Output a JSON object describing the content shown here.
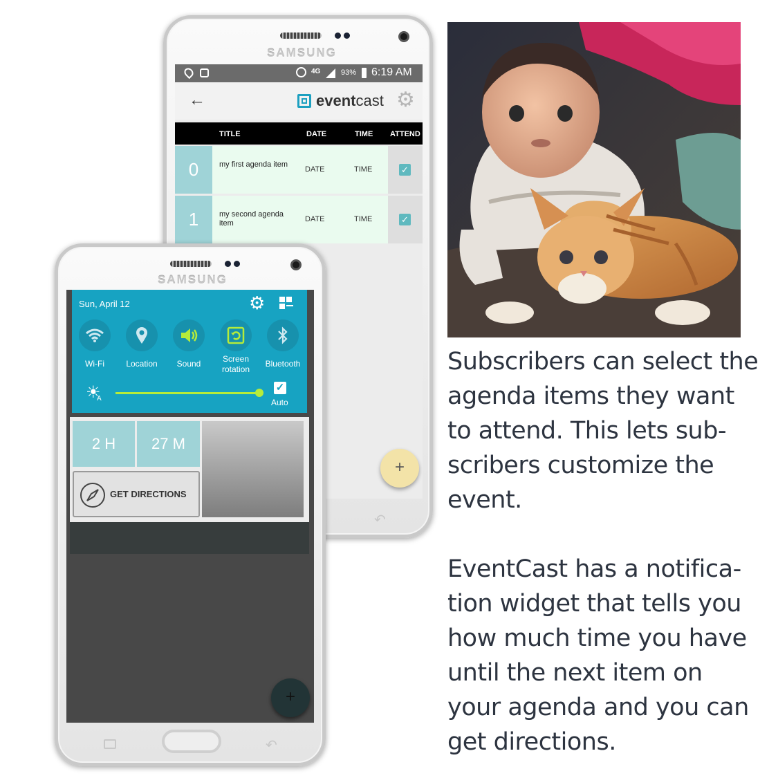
{
  "back_phone": {
    "brand": "SAMSUNG",
    "status": {
      "network": "4G",
      "battery": "93%",
      "time": "6:19 AM"
    },
    "app": {
      "logo_text_bold": "event",
      "logo_text_light": "cast",
      "columns": [
        "TITLE",
        "DATE",
        "TIME",
        "ATTEND"
      ],
      "rows": [
        {
          "index": "0",
          "title": "my first agenda item",
          "date": "DATE",
          "time": "TIME",
          "attend": true
        },
        {
          "index": "1",
          "title": "my second agenda item",
          "date": "DATE",
          "time": "TIME",
          "attend": true
        }
      ],
      "fab_label": "+"
    }
  },
  "front_phone": {
    "brand": "SAMSUNG",
    "quick_settings": {
      "date": "Sun, April 12",
      "toggles": [
        {
          "label": "Wi-Fi",
          "icon": "wifi-icon",
          "active": false
        },
        {
          "label": "Location",
          "icon": "location-icon",
          "active": false
        },
        {
          "label": "Sound",
          "icon": "sound-icon",
          "active": true
        },
        {
          "label": "Screen rotation",
          "icon": "screen-rotation-icon",
          "active": true
        },
        {
          "label": "Bluetooth",
          "icon": "bluetooth-icon",
          "active": false
        }
      ],
      "brightness_level": 1.0,
      "auto_label": "Auto",
      "auto_checked": true
    },
    "widget": {
      "hours": "2 H",
      "minutes": "27 M",
      "directions_label": "GET DIRECTIONS"
    },
    "fab_label": "+"
  },
  "captions": {
    "first": [
      "Subscribers can select the",
      "agenda items they want",
      "to attend. This lets sub-",
      "scribers customize the",
      "event."
    ],
    "second": [
      "EventCast has a notifica-",
      "tion widget that tells you",
      "how much time you have",
      "until the next item on",
      "your agenda and you can",
      "get directions."
    ]
  },
  "colors": {
    "teal": "#17a3c2",
    "row_index": "#9fd3d7",
    "row_body": "#eafbef",
    "fab_back": "#f3e3a8",
    "fab_front": "#223436",
    "caption": "#2d3440"
  }
}
